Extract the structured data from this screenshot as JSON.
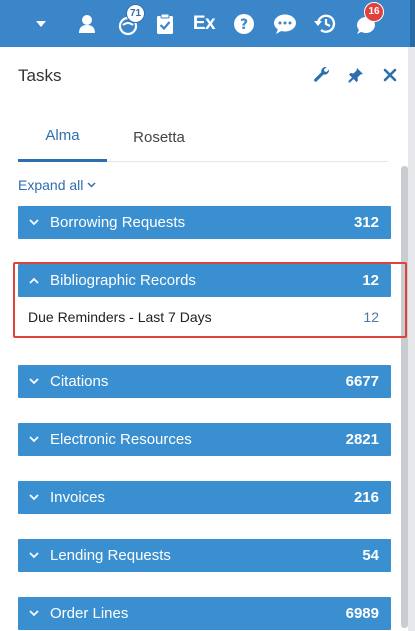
{
  "toolbar": {
    "items": [
      {
        "icon": "chevron-down-icon"
      },
      {
        "icon": "user-icon"
      },
      {
        "icon": "notifications-icon",
        "badge": "71"
      },
      {
        "icon": "clipboard-check-icon"
      },
      {
        "icon": "ex-icon",
        "text": "Ex"
      },
      {
        "icon": "help-icon"
      },
      {
        "icon": "chat-icon"
      },
      {
        "icon": "history-icon"
      },
      {
        "icon": "alerts-icon",
        "badge": "16"
      }
    ]
  },
  "panel": {
    "title": "Tasks",
    "icons": [
      "wrench-icon",
      "pin-icon",
      "close-icon"
    ]
  },
  "tabs": [
    {
      "label": "Alma",
      "active": true
    },
    {
      "label": "Rosetta",
      "active": false
    }
  ],
  "expand_all": "Expand all",
  "categories": [
    {
      "label": "Borrowing Requests",
      "count": "312",
      "expanded": false
    },
    {
      "label": "Bibliographic Records",
      "count": "12",
      "expanded": true
    },
    {
      "label": "Citations",
      "count": "6677",
      "expanded": false
    },
    {
      "label": "Electronic Resources",
      "count": "2821",
      "expanded": false
    },
    {
      "label": "Invoices",
      "count": "216",
      "expanded": false
    },
    {
      "label": "Lending Requests",
      "count": "54",
      "expanded": false
    },
    {
      "label": "Order Lines",
      "count": "6989",
      "expanded": false
    }
  ],
  "bib_subitems": [
    {
      "label": "Due Reminders - Last 7 Days",
      "count": "12"
    }
  ],
  "colors": {
    "toolbar_bg": "#3b86c9",
    "category_bg": "#3a8fd0",
    "accent": "#2d6fae",
    "highlight": "#e0413a",
    "badge_red": "#e0413a"
  }
}
